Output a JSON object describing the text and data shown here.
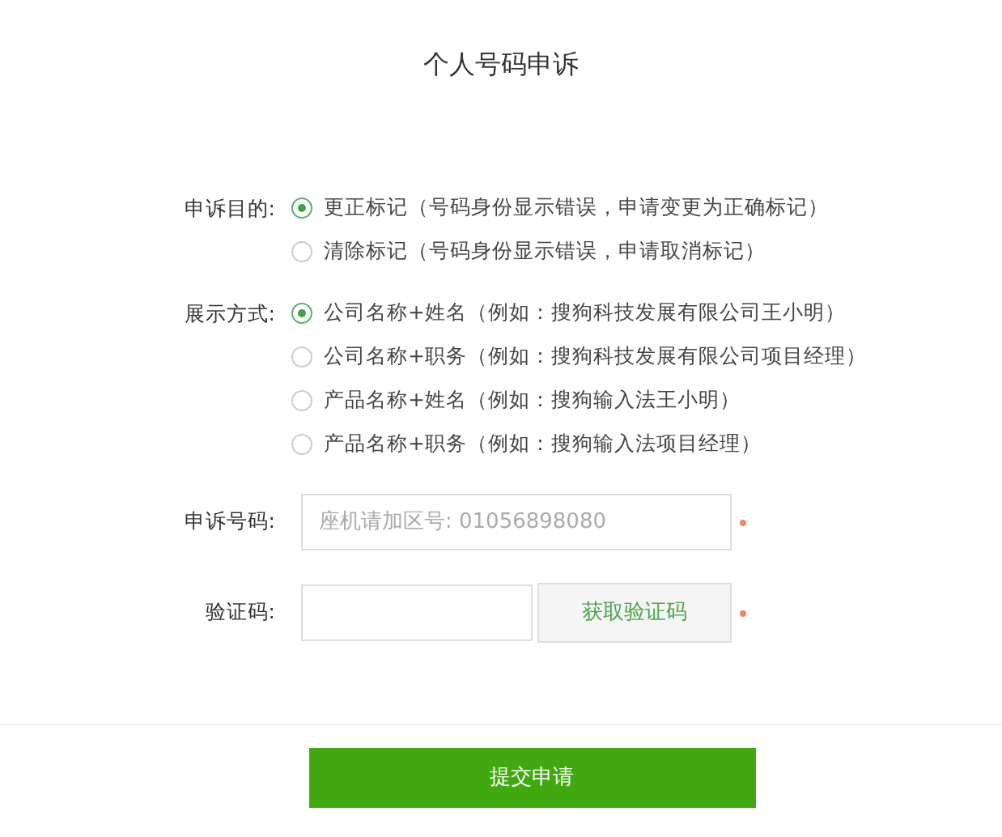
{
  "title": "个人号码申诉",
  "groups": [
    {
      "label": "申诉目的:",
      "options": [
        {
          "text": "更正标记（号码身份显示错误，申请变更为正确标记）",
          "selected": true
        },
        {
          "text": "清除标记（号码身份显示错误，申请取消标记）",
          "selected": false
        }
      ]
    },
    {
      "label": "展示方式:",
      "options": [
        {
          "text": "公司名称+姓名（例如：搜狗科技发展有限公司王小明）",
          "selected": true
        },
        {
          "text": "公司名称+职务（例如：搜狗科技发展有限公司项目经理）",
          "selected": false
        },
        {
          "text": "产品名称+姓名（例如：搜狗输入法王小明）",
          "selected": false
        },
        {
          "text": "产品名称+职务（例如：搜狗输入法项目经理）",
          "selected": false
        }
      ]
    }
  ],
  "phone": {
    "label": "申诉号码:",
    "placeholder": "座机请加区号: 01056898080"
  },
  "code": {
    "label": "验证码:",
    "button": "获取验证码"
  },
  "submit": "提交申请"
}
